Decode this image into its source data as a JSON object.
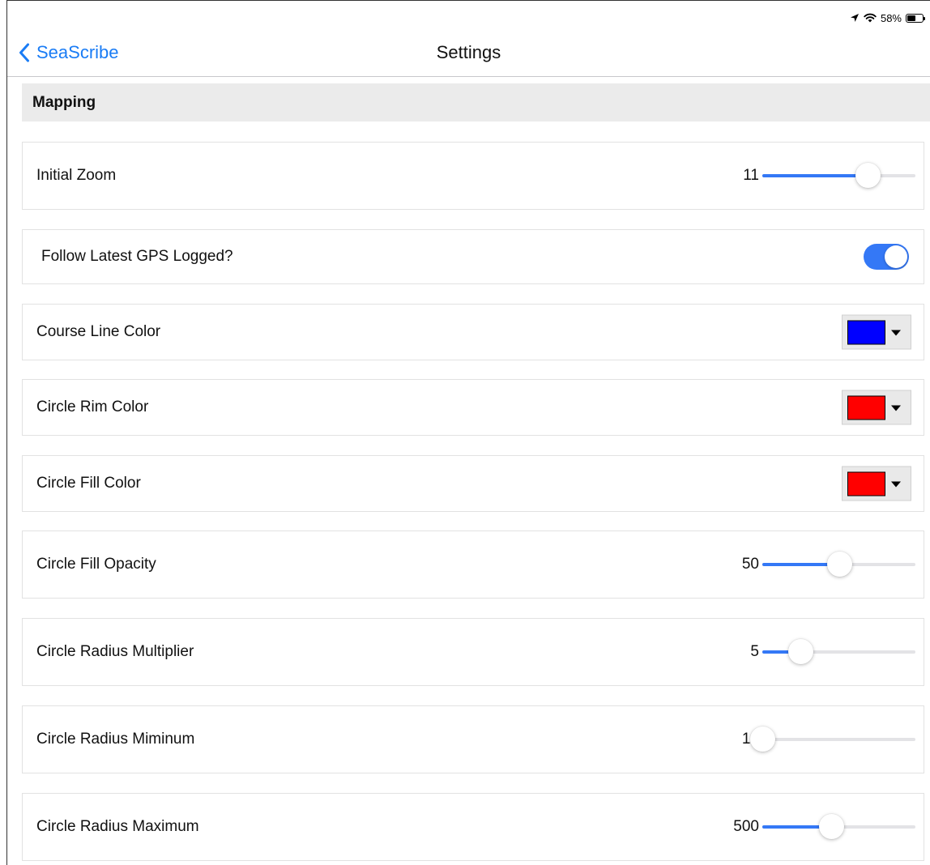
{
  "status_bar": {
    "battery_percent": "58%",
    "battery_level": 0.58
  },
  "nav": {
    "back_label": "SeaScribe",
    "title": "Settings"
  },
  "section": {
    "title": "Mapping"
  },
  "rows": {
    "initial_zoom": {
      "label": "Initial Zoom",
      "value": "11",
      "fraction": 0.69
    },
    "follow_gps": {
      "label": "Follow Latest GPS Logged?",
      "on": true
    },
    "course_line_color": {
      "label": "Course Line Color",
      "color": "#0000ff"
    },
    "circle_rim_color": {
      "label": "Circle Rim Color",
      "color": "#ff0000"
    },
    "circle_fill_color": {
      "label": "Circle Fill Color",
      "color": "#ff0000"
    },
    "circle_fill_opacity": {
      "label": "Circle Fill Opacity",
      "value": "50",
      "fraction": 0.5
    },
    "circle_radius_multiplier": {
      "label": "Circle Radius Multiplier",
      "value": "5",
      "fraction": 0.25
    },
    "circle_radius_minimum": {
      "label": "Circle Radius Miminum",
      "value": "10",
      "fraction": 0.0
    },
    "circle_radius_maximum": {
      "label": "Circle Radius Maximum",
      "value": "500",
      "fraction": 0.45
    }
  },
  "colors": {
    "accent": "#3478f6",
    "link": "#1a7cf5",
    "section_bg": "#ebebeb"
  },
  "icons": {
    "status": [
      "location-arrow-icon",
      "wifi-icon",
      "battery-icon"
    ],
    "back": "chevron-left-icon",
    "dropdown": "caret-down-icon"
  }
}
